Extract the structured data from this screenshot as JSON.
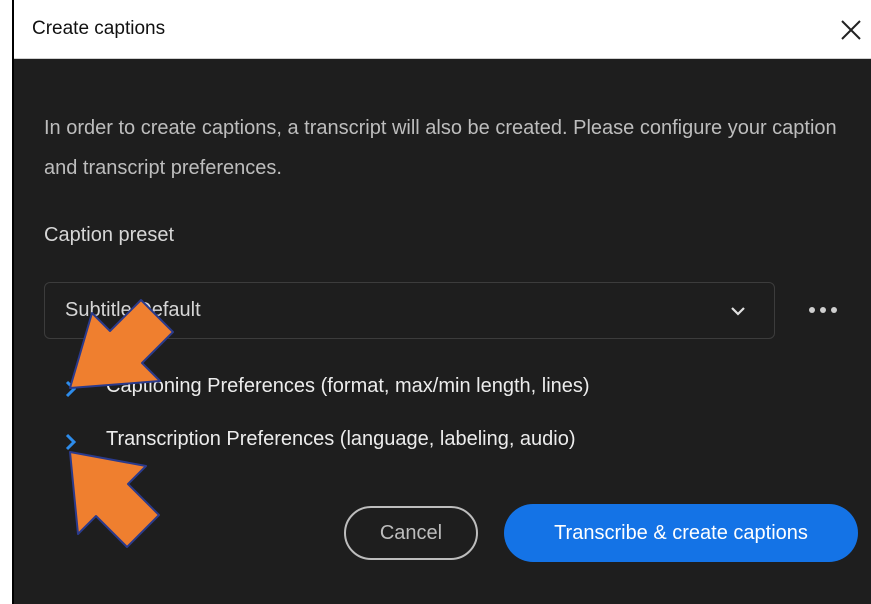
{
  "dialog": {
    "title": "Create captions",
    "description": "In order to create captions, a transcript will also be created. Please configure your caption and transcript preferences.",
    "preset_label": "Caption preset",
    "preset_value": "Subtitle Default",
    "sections": [
      {
        "label": "Captioning Preferences (format, max/min length, lines)"
      },
      {
        "label": "Transcription Preferences (language, labeling, audio)"
      }
    ],
    "cancel_label": "Cancel",
    "primary_label": "Transcribe & create captions"
  },
  "colors": {
    "dialog_bg": "#1e1e1e",
    "accent": "#1473e6",
    "annotation_arrow": "#ef7f2f"
  },
  "icons": {
    "close": "close-icon",
    "dropdown": "chevron-down-icon",
    "more": "more-icon",
    "expand": "chevron-right-icon"
  }
}
